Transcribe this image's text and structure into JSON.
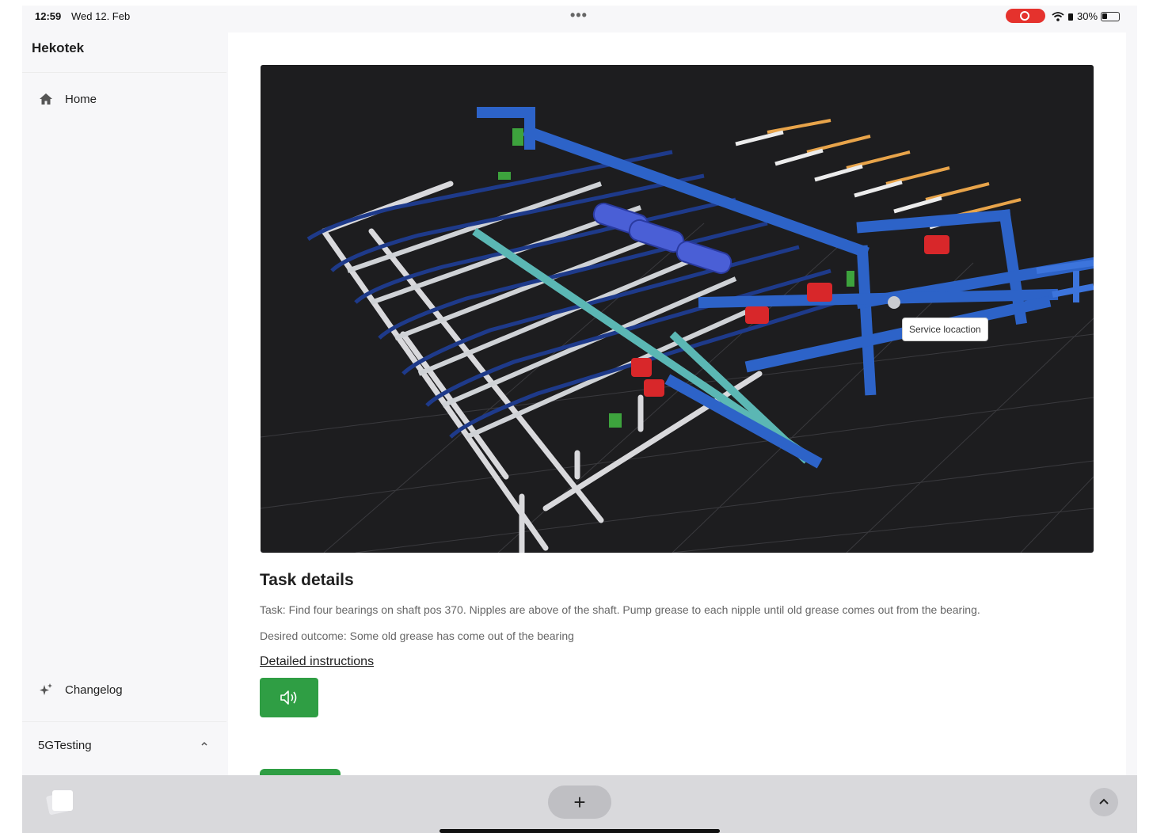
{
  "status_bar": {
    "time": "12:59",
    "date": "Wed 12. Feb",
    "battery": "30%"
  },
  "sidebar": {
    "brand": "Hekotek",
    "home_label": "Home",
    "changelog_label": "Changelog",
    "group_label": "5GTesting",
    "group_chevron": "^"
  },
  "viewer": {
    "tooltip": "Service locaction"
  },
  "task": {
    "title": "Task details",
    "text": "Task: Find four bearings on shaft pos 370. Nipples are above of the shaft. Pump grease to each nipple until old grease comes out from the bearing.",
    "outcome": "Desired outcome: Some old grease has come out of the bearing",
    "instructions_link": "Detailed instructions"
  },
  "bottom_bar": {
    "plus_label": "+"
  },
  "icons": {
    "home": "home-icon",
    "changelog": "sparkle-icon",
    "audio": "speaker-icon",
    "chevron": "chevron-up-icon"
  },
  "colors": {
    "accent_green": "#2f9e44",
    "viewer_bg": "#1d1d1f",
    "frame_blue": "#2d63c8",
    "motor_red": "#d8272a",
    "rail_teal": "#5bb7b4"
  }
}
